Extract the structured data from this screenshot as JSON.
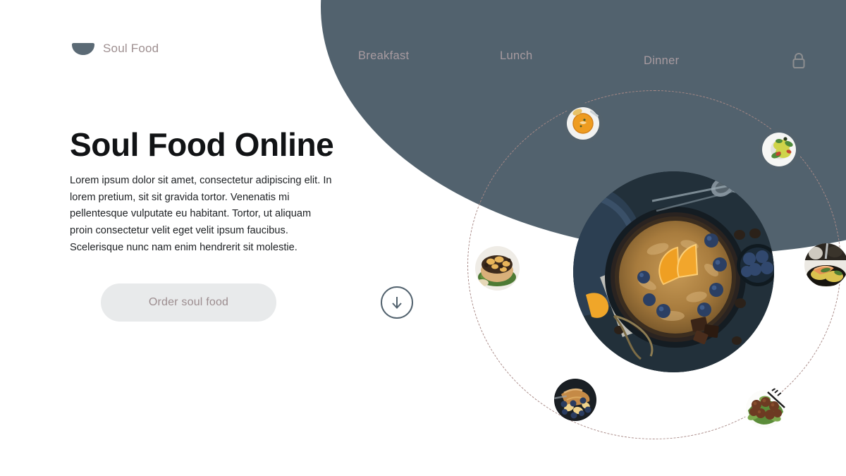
{
  "brand": {
    "logo_icon": "bowl-icon",
    "name": "Soul Food"
  },
  "nav": {
    "items": [
      {
        "label": "Breakfast"
      },
      {
        "label": "Lunch"
      },
      {
        "label": "Dinner"
      }
    ],
    "account_icon": "lock-icon"
  },
  "hero": {
    "headline": "Soul Food Online",
    "body": "Lorem ipsum dolor sit amet, consectetur adipiscing elit. In lorem pretium, sit sit gravida tortor. Venenatis mi pellentesque vulputate eu habitant. Tortor, ut aliquam proin consectetur velit eget velit ipsum faucibus. Scelerisque nunc nam enim hendrerit sit molestie.",
    "cta_label": "Order soul food",
    "scroll_icon": "arrow-down-circle-icon"
  },
  "gallery": {
    "main": {
      "name": "skillet-pancake-with-orange-and-blueberries"
    },
    "thumbnails": [
      {
        "name": "pumpkin-soup-bowl"
      },
      {
        "name": "rice-salad-plate"
      },
      {
        "name": "stuffed-burger"
      },
      {
        "name": "salmon-grain-plate"
      },
      {
        "name": "blueberry-banana-toast"
      },
      {
        "name": "meatballs-on-greens"
      }
    ]
  },
  "colors": {
    "slate": "#52626e",
    "mauve": "#a98a87",
    "muted_text": "#a89ba0",
    "cta_bg": "#e8eaeb",
    "heading": "#111315"
  }
}
